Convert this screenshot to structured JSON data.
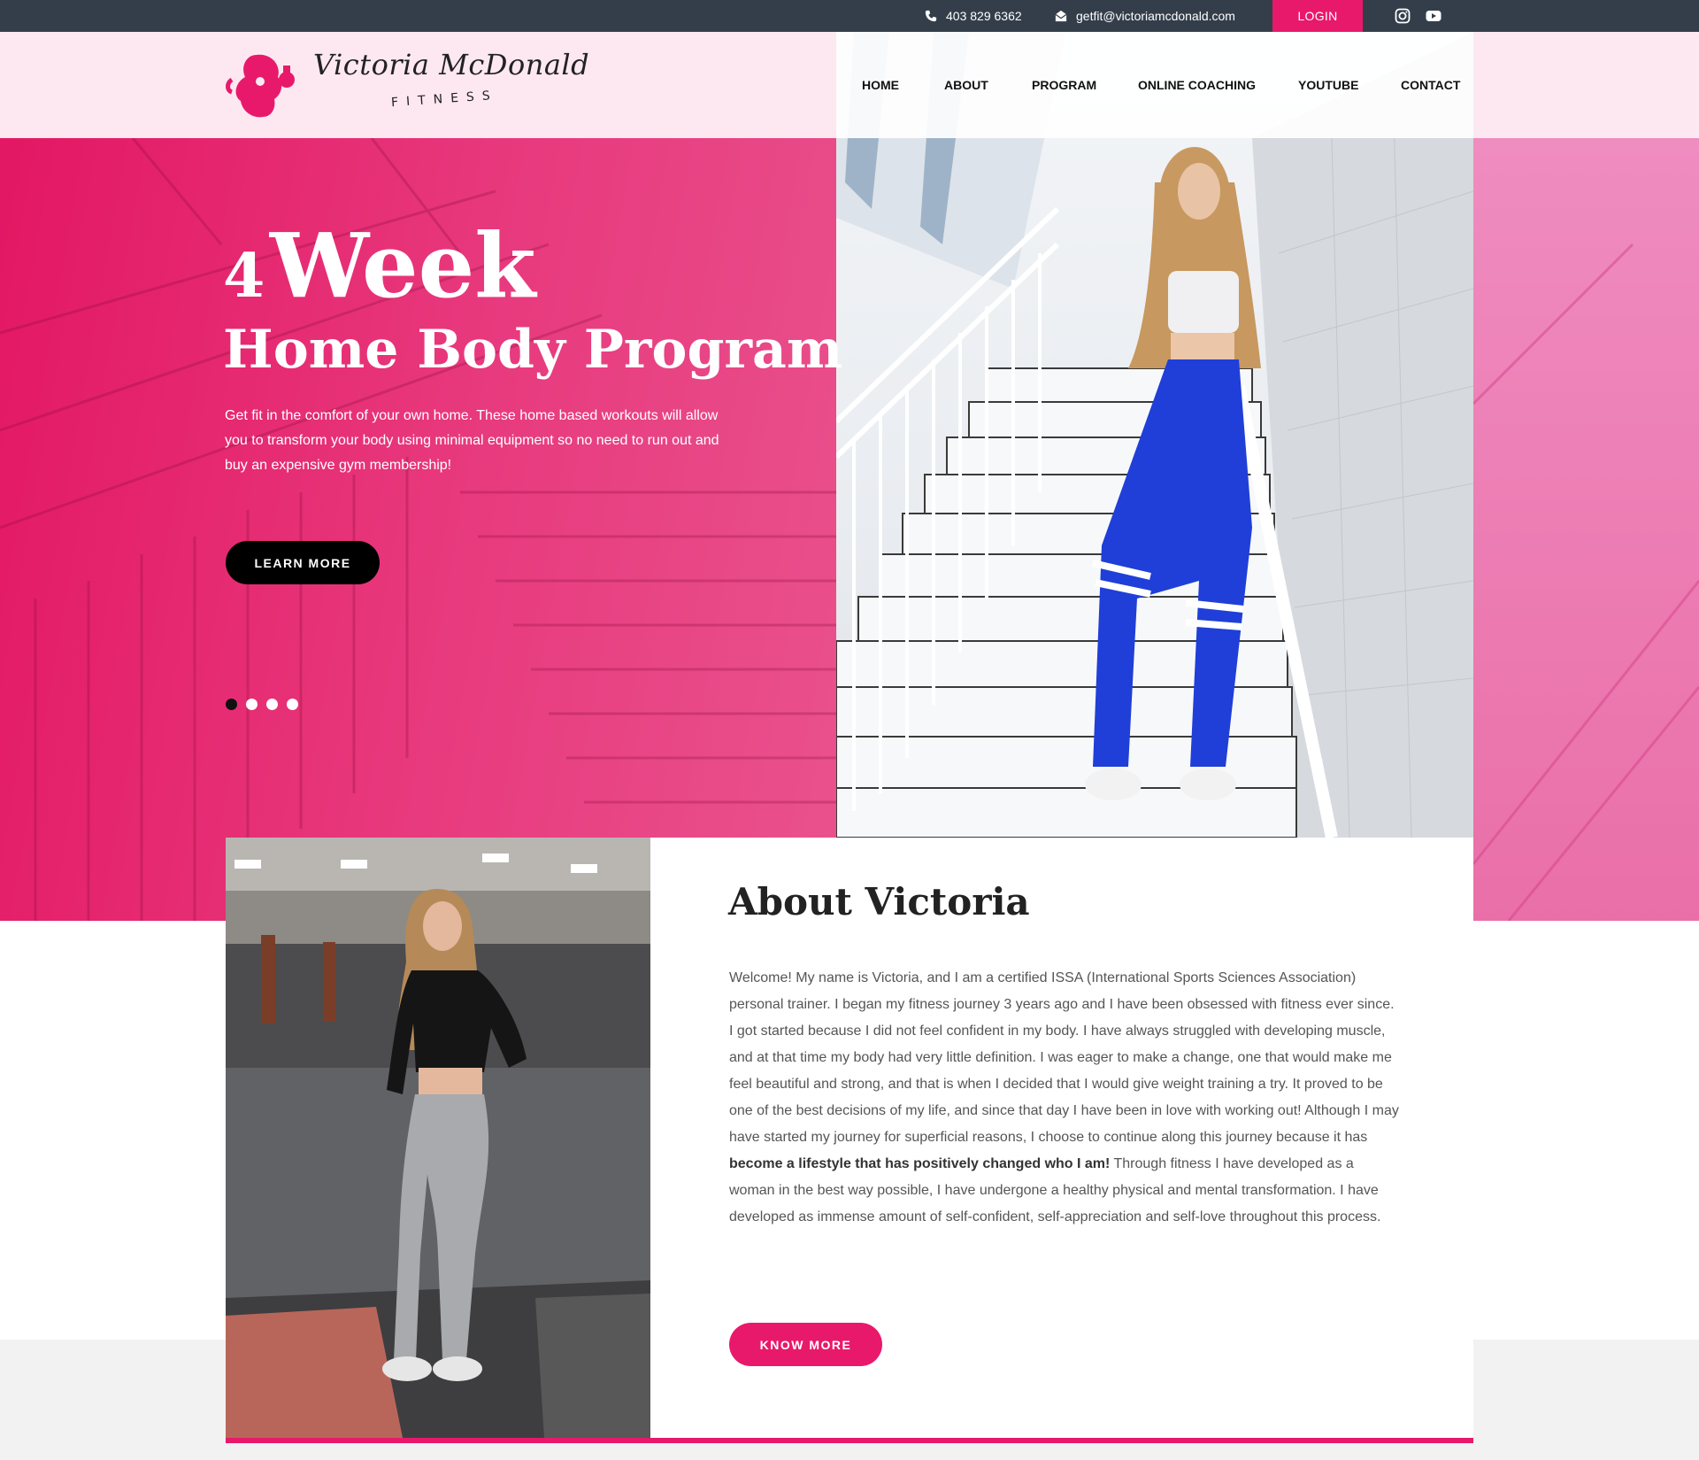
{
  "topbar": {
    "phone": "403 829 6362",
    "email": "getfit@victoriamcdonald.com",
    "login": "LOGIN",
    "social": [
      "instagram-icon",
      "youtube-icon"
    ]
  },
  "logo": {
    "script": "Victoria McDonald",
    "sub": "FITNESS"
  },
  "nav": [
    "HOME",
    "ABOUT",
    "PROGRAM",
    "ONLINE COACHING",
    "YOUTUBE",
    "CONTACT"
  ],
  "hero": {
    "number": "4",
    "word": "Week",
    "subtitle": "Home Body Program",
    "description": "Get fit in the comfort of your own home. These home based workouts will allow you to transform your body using minimal equipment so no need to run out and buy an expensive gym membership!",
    "button": "LEARN MORE",
    "slides": 4,
    "active_slide": 1
  },
  "about": {
    "title": "About Victoria",
    "text_before": "Welcome! My name is Victoria, and I am a certified ISSA (International Sports Sciences Association) personal trainer. I began my fitness journey 3 years ago and I have been obsessed with fitness ever since. I got started because I did not feel confident in my body. I have always struggled with developing muscle, and at that time my body had very little definition. I was eager to make a change, one that would make me feel beautiful and strong, and that is when I decided that I would give weight training a try. It proved to be one of the best decisions of my life, and since that day I have been in love with working out! Although I may have started my journey for superficial reasons, I choose to continue along this journey because it has ",
    "text_bold": "become a lifestyle that has positively changed who I am!",
    "text_after": " Through fitness I have developed as a woman in the best way possible, I have undergone a healthy physical and mental transformation. I have developed as immense amount of self-confident, self-appreciation and self-love throughout this process.",
    "button": "KNOW MORE"
  },
  "colors": {
    "accent": "#e8196b",
    "topbar": "#343e4b",
    "header_tint": "#fde8f1"
  }
}
